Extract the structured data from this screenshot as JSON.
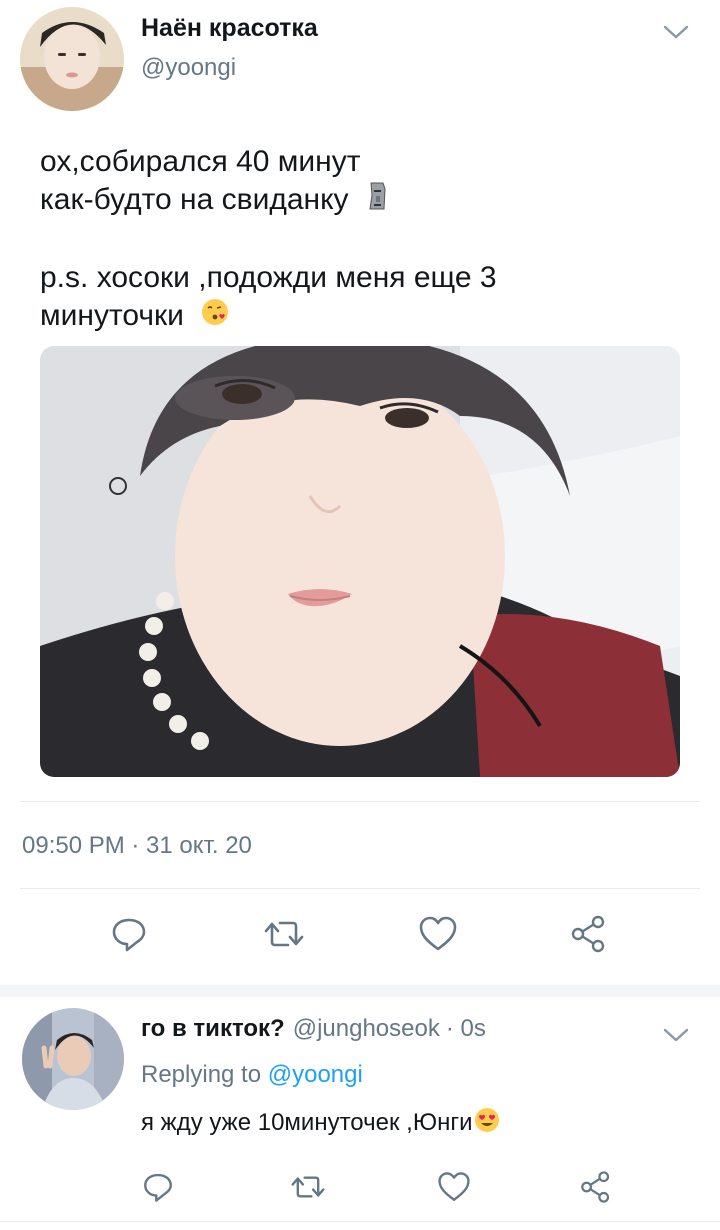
{
  "tweet": {
    "display_name": "Наён красотка",
    "handle": "@yoongi",
    "text_lines": [
      "ох,собирался 40 минут",
      "как-будто на свиданку",
      "",
      "p.s. хосоки ,подожди меня еще 3",
      "минуточки"
    ],
    "timestamp": "09:50 PM · 31 окт. 20",
    "icons": [
      "reply-icon",
      "retweet-icon",
      "like-icon",
      "share-icon"
    ]
  },
  "reply": {
    "display_name": "го в тикток?",
    "handle": "@junghoseok",
    "time": "· 0s",
    "replying_prefix": "Replying to",
    "replying_to": "@yoongi",
    "text": "я жду уже 10минуточек ,Юнги"
  },
  "colors": {
    "text": "#14171a",
    "secondary": "#657786",
    "accent": "#1da1f2",
    "divider": "#e6ecf0"
  }
}
